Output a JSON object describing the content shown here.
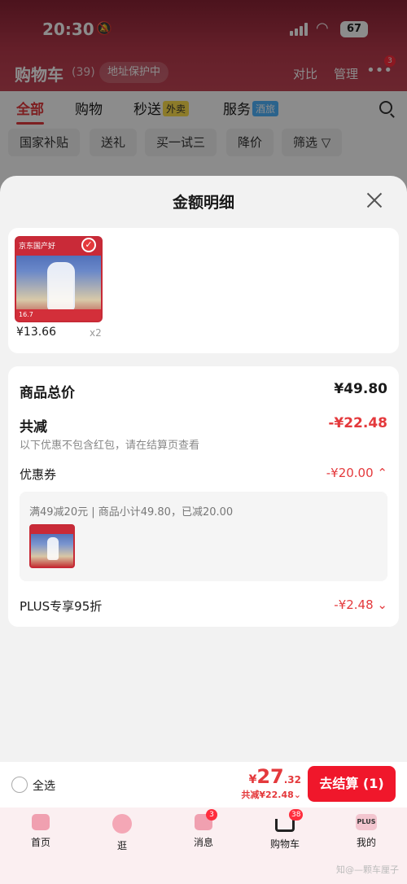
{
  "status_bar": {
    "time": "20:30",
    "battery": "67"
  },
  "cart_header": {
    "title": "购物车",
    "count": "(39)",
    "address_pill": "地址保护中",
    "compare": "对比",
    "manage": "管理",
    "more_badge": "3"
  },
  "tabs": [
    {
      "label": "全部",
      "tag": ""
    },
    {
      "label": "购物",
      "tag": ""
    },
    {
      "label": "秒送",
      "tag": "外卖"
    },
    {
      "label": "服务",
      "tag": "酒旅"
    }
  ],
  "chips": [
    "国家补贴",
    "送礼",
    "买一试三",
    "降价",
    "筛选"
  ],
  "sheet": {
    "title": "金额明细",
    "product": {
      "price": "¥13.66",
      "qty": "x2",
      "image_banner": "京东国产好",
      "image_strip": "16.7"
    },
    "total_label": "商品总价",
    "total_value": "¥49.80",
    "reduce_label": "共减",
    "reduce_value": "-¥22.48",
    "reduce_note": "以下优惠不包含红包，请在结算页查看",
    "coupon_label": "优惠券",
    "coupon_value": "-¥20.00",
    "coupon_desc": "满49减20元 | 商品小计49.80，已减20.00",
    "plus_label": "PLUS专享95折",
    "plus_value": "-¥2.48"
  },
  "checkout": {
    "select_all": "全选",
    "total_yen": "¥",
    "total_int": "27",
    "total_dec": ".32",
    "saved": "共减¥22.48",
    "button": "去结算 (1)"
  },
  "tabbar": [
    {
      "label": "首页",
      "badge": ""
    },
    {
      "label": "逛",
      "badge": ""
    },
    {
      "label": "消息",
      "badge": "3"
    },
    {
      "label": "购物车",
      "badge": "38"
    },
    {
      "label": "我的",
      "badge": ""
    }
  ],
  "tabbar_plus_text": "PLUS",
  "watermark": "知@—颗车厘子"
}
